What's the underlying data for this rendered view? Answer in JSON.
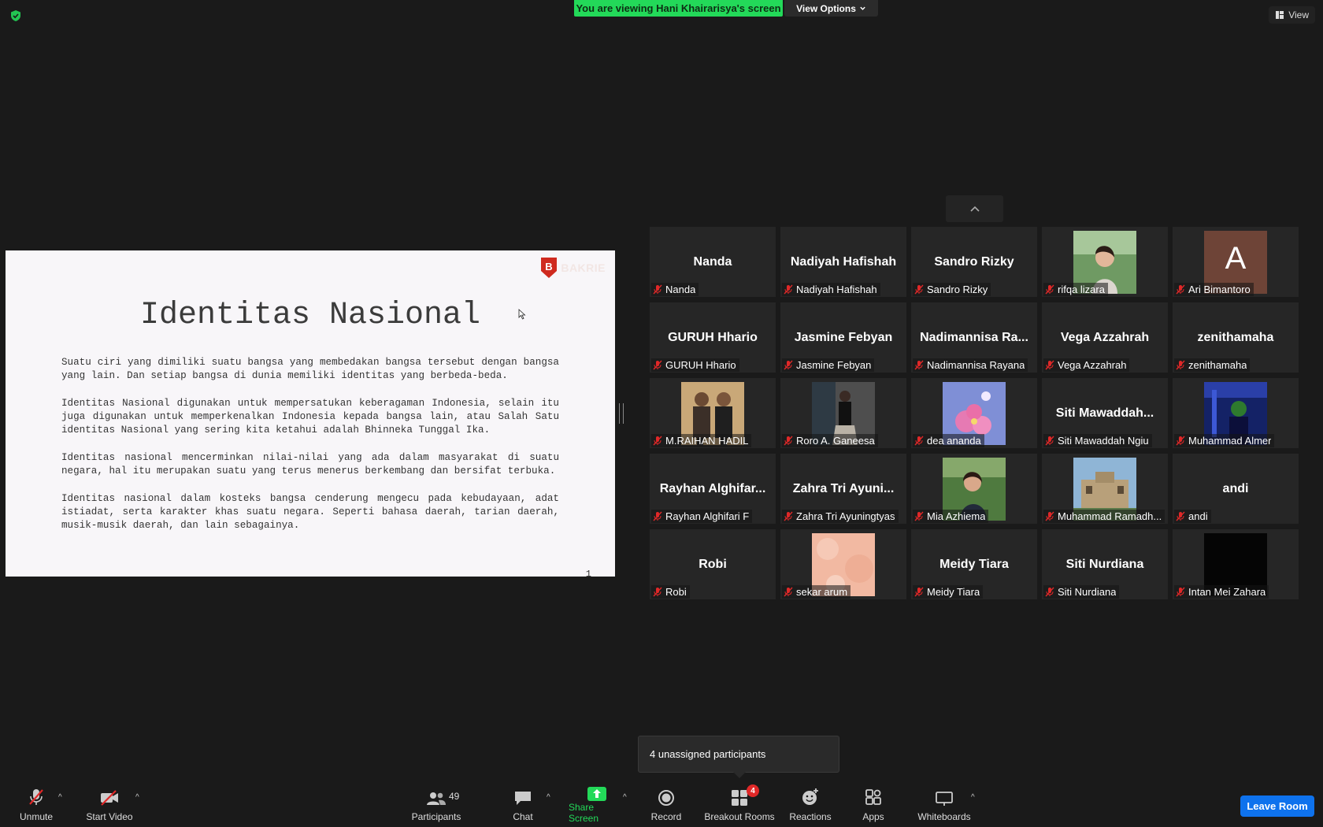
{
  "banner": {
    "viewing_text": "You are viewing Hani Khairarisya's screen",
    "view_options_label": "View Options",
    "view_label": "View"
  },
  "slide": {
    "logo_text": "BAKRIE",
    "title": "Identitas Nasional",
    "paragraphs": [
      "Suatu ciri yang dimiliki suatu bangsa yang membedakan bangsa tersebut dengan bangsa yang lain.  Dan setiap bangsa di dunia memiliki identitas yang berbeda-beda.",
      "Identitas Nasional digunakan untuk mempersatukan keberagaman Indonesia, selain itu juga digunakan untuk memperkenalkan Indonesia kepada bangsa lain, atau Salah Satu identitas Nasional yang sering kita ketahui adalah Bhinneka Tunggal Ika.",
      "Identitas nasional mencerminkan nilai-nilai yang ada dalam masyarakat di suatu negara, hal itu merupakan suatu yang terus menerus berkembang dan bersifat terbuka.",
      "Identitas nasional dalam kosteks bangsa cenderung mengecu pada kebudayaan, adat istiadat, serta karakter khas suatu negara. Seperti bahasa daerah, tarian daerah, musik-musik daerah, dan lain sebagainya."
    ],
    "page_number": "1"
  },
  "participants": [
    {
      "big": "Nanda",
      "name": "Nanda"
    },
    {
      "big": "Nadiyah Hafishah",
      "name": "Nadiyah Hafishah"
    },
    {
      "big": "Sandro Rizky",
      "name": "Sandro Rizky"
    },
    {
      "big": "",
      "name": "rifqa lizara",
      "photo": "photo-woman-garden"
    },
    {
      "big": "A",
      "name": "Ari Bimantoro",
      "avatar": "#6e4437"
    },
    {
      "big": "GURUH Hhario",
      "name": "GURUH Hhario"
    },
    {
      "big": "Jasmine Febyan",
      "name": "Jasmine Febyan"
    },
    {
      "big": "Nadimannisa Ra...",
      "name": "Nadimannisa Rayana"
    },
    {
      "big": "Vega Azzahrah",
      "name": "Vega Azzahrah"
    },
    {
      "big": "zenithamaha",
      "name": "zenithamaha"
    },
    {
      "big": "",
      "name": "M.RAIHAN HADIL",
      "photo": "photo-two-men"
    },
    {
      "big": "",
      "name": "Roro A. Ganeesa",
      "photo": "photo-dark-figure"
    },
    {
      "big": "",
      "name": "dea ananda",
      "photo": "photo-pink-flowers"
    },
    {
      "big": "Siti  Mawaddah...",
      "name": "Siti Mawaddah Ngiu"
    },
    {
      "big": "",
      "name": "Muhammad Almer",
      "photo": "photo-blue-neon"
    },
    {
      "big": "Rayhan  Alghifar...",
      "name": "Rayhan Alghifari F"
    },
    {
      "big": "Zahra Tri Ayuni...",
      "name": "Zahra Tri Ayuningtyas"
    },
    {
      "big": "",
      "name": "Mia Azhiema",
      "photo": "photo-woman-outdoor"
    },
    {
      "big": "",
      "name": "Muhammad Ramadh...",
      "photo": "photo-building"
    },
    {
      "big": "andi",
      "name": "andi"
    },
    {
      "big": "Robi",
      "name": "Robi"
    },
    {
      "big": "",
      "name": "sekar arum",
      "photo": "photo-peach-texture"
    },
    {
      "big": "Meidy Tiara",
      "name": "Meidy Tiara"
    },
    {
      "big": "Siti Nurdiana",
      "name": "Siti Nurdiana"
    },
    {
      "big": "",
      "name": "Intan Mei Zahara",
      "photo": "photo-black"
    }
  ],
  "tooltip": {
    "text": "4 unassigned participants"
  },
  "toolbar": {
    "unmute": "Unmute",
    "start_video": "Start Video",
    "participants": "Participants",
    "participants_count": "49",
    "chat": "Chat",
    "share_screen": "Share Screen",
    "record": "Record",
    "breakout_rooms": "Breakout Rooms",
    "breakout_badge": "4",
    "reactions": "Reactions",
    "apps": "Apps",
    "whiteboards": "Whiteboards",
    "leave_room": "Leave Room"
  },
  "colors": {
    "banner_green": "#23d959",
    "share_green": "#23d959",
    "leave_blue": "#0e72ed",
    "muted_red": "#e02828"
  }
}
